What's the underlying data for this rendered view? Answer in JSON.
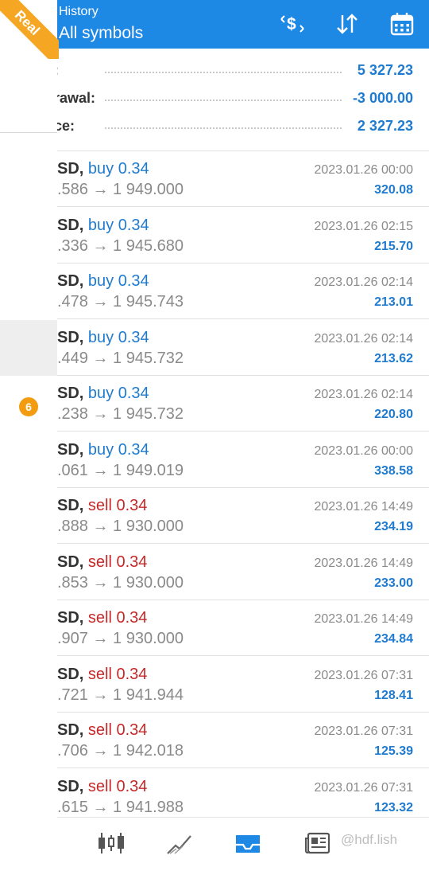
{
  "header": {
    "subtitle": "History",
    "title": "All symbols",
    "badge": "Real",
    "icons": [
      "currency-exchange-icon",
      "sort-icon",
      "calendar-icon"
    ]
  },
  "summary": [
    {
      "label": ":",
      "value": "5 327.23"
    },
    {
      "label": "rawal:",
      "value": "-3 000.00"
    },
    {
      "label": "ce:",
      "value": "2 327.23"
    }
  ],
  "left_badge": "6",
  "trades": [
    {
      "symbol": "SD,",
      "side": "buy",
      "volume": "buy 0.34",
      "prices": ".586 → 1 949.000",
      "time": "2023.01.26 00:00",
      "profit": "320.08"
    },
    {
      "symbol": "SD,",
      "side": "buy",
      "volume": "buy 0.34",
      "prices": ".336 → 1 945.680",
      "time": "2023.01.26 02:15",
      "profit": "215.70"
    },
    {
      "symbol": "SD,",
      "side": "buy",
      "volume": "buy 0.34",
      "prices": ".478 → 1 945.743",
      "time": "2023.01.26 02:14",
      "profit": "213.01"
    },
    {
      "symbol": "SD,",
      "side": "buy",
      "volume": "buy 0.34",
      "prices": ".449 → 1 945.732",
      "time": "2023.01.26 02:14",
      "profit": "213.62"
    },
    {
      "symbol": "SD,",
      "side": "buy",
      "volume": "buy 0.34",
      "prices": ".238 → 1 945.732",
      "time": "2023.01.26 02:14",
      "profit": "220.80"
    },
    {
      "symbol": "SD,",
      "side": "buy",
      "volume": "buy 0.34",
      "prices": ".061 → 1 949.019",
      "time": "2023.01.26 00:00",
      "profit": "338.58"
    },
    {
      "symbol": "SD,",
      "side": "sell",
      "volume": "sell 0.34",
      "prices": ".888 → 1 930.000",
      "time": "2023.01.26 14:49",
      "profit": "234.19"
    },
    {
      "symbol": "SD,",
      "side": "sell",
      "volume": "sell 0.34",
      "prices": ".853 → 1 930.000",
      "time": "2023.01.26 14:49",
      "profit": "233.00"
    },
    {
      "symbol": "SD,",
      "side": "sell",
      "volume": "sell 0.34",
      "prices": ".907 → 1 930.000",
      "time": "2023.01.26 14:49",
      "profit": "234.84"
    },
    {
      "symbol": "SD,",
      "side": "sell",
      "volume": "sell 0.34",
      "prices": ".721 → 1 941.944",
      "time": "2023.01.26 07:31",
      "profit": "128.41"
    },
    {
      "symbol": "SD,",
      "side": "sell",
      "volume": "sell 0.34",
      "prices": ".706 → 1 942.018",
      "time": "2023.01.26 07:31",
      "profit": "125.39"
    },
    {
      "symbol": "SD,",
      "side": "sell",
      "volume": "sell 0.34",
      "prices": ".615 → 1 941.988",
      "time": "2023.01.26 07:31",
      "profit": "123.32"
    }
  ],
  "bottom_nav": {
    "items": [
      "quotes-candlestick-icon",
      "chart-icon",
      "trade-inbox-icon",
      "news-icon"
    ],
    "active": "trade-inbox-icon"
  },
  "watermark": "@hdf.lish",
  "colors": {
    "header": "#1e88e5",
    "buy": "#1f7bd0",
    "sell": "#c62828",
    "badge": "#f39c12",
    "ribbon": "#f5a623"
  }
}
